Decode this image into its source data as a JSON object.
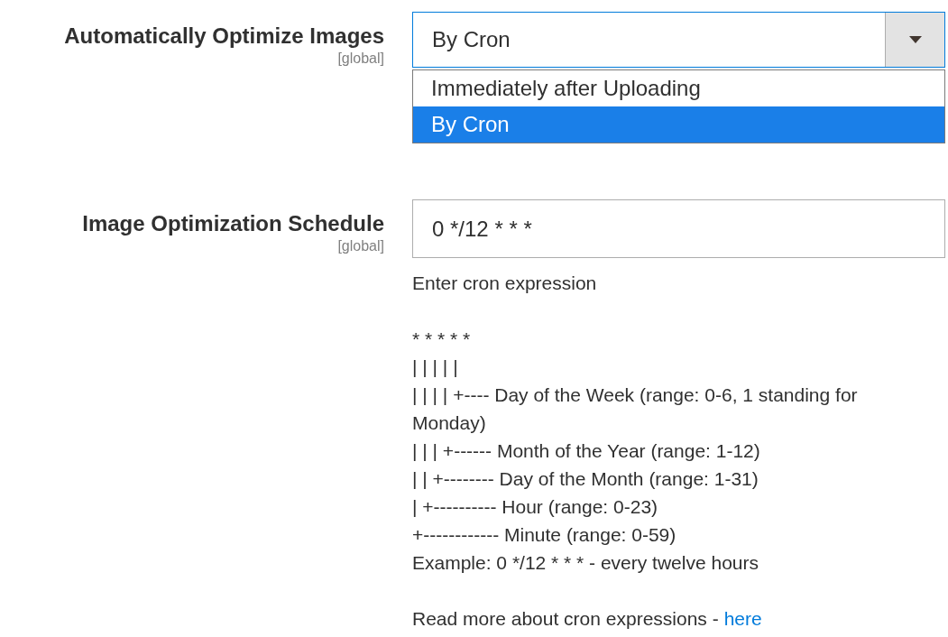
{
  "fields": [
    {
      "kind": "select",
      "label": "Automatically Optimize Images",
      "scope": "[global]",
      "value": "By Cron",
      "expanded": true,
      "options": [
        {
          "label": "Immediately after Uploading",
          "selected": false
        },
        {
          "label": "By Cron",
          "selected": true
        }
      ]
    },
    {
      "kind": "text",
      "label": "Image Optimization Schedule",
      "scope": "[global]",
      "value": "0 */12 * * *",
      "note": "Enter cron expression",
      "help_lines": [
        "* * * * *",
        "| | | | |",
        "| | | | +---- Day of the Week (range: 0-6, 1 standing for Monday)",
        "| | | +------ Month of the Year (range: 1-12)",
        "| | +-------- Day of the Month (range: 1-31)",
        "| +---------- Hour (range: 0-23)",
        "+------------ Minute (range: 0-59)",
        "Example: 0 */12 * * * - every twelve hours"
      ],
      "more": {
        "text": "Read more about cron expressions -",
        "link": "here"
      }
    }
  ]
}
